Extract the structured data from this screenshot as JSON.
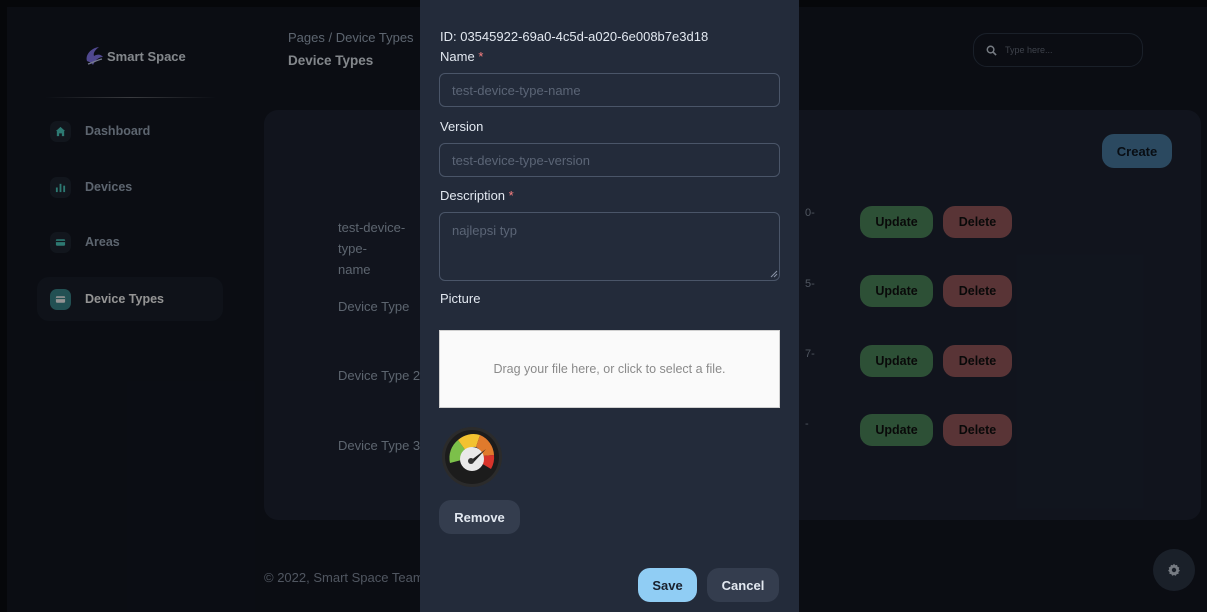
{
  "sidebar": {
    "logo_text": "Smart Space",
    "items": [
      {
        "label": "Dashboard",
        "icon": "home-icon"
      },
      {
        "label": "Devices",
        "icon": "bar-chart-icon"
      },
      {
        "label": "Areas",
        "icon": "credit-card-icon"
      },
      {
        "label": "Device Types",
        "icon": "credit-card-icon",
        "active": true
      }
    ]
  },
  "header": {
    "breadcrumb_root": "Pages",
    "breadcrumb_sep": "/",
    "breadcrumb_current": "Device Types",
    "title": "Device Types",
    "search_placeholder": "Type here..."
  },
  "main": {
    "create_label": "Create",
    "rows": [
      {
        "name": "test-device-type-\nname",
        "id_fragment": "0-",
        "update_label": "Update",
        "delete_label": "Delete"
      },
      {
        "name": "Device Type",
        "id_fragment": "5-",
        "update_label": "Update",
        "delete_label": "Delete"
      },
      {
        "name": "Device Type 2",
        "id_fragment": "7-",
        "update_label": "Update",
        "delete_label": "Delete"
      },
      {
        "name": "Device Type 3",
        "id_fragment": "-",
        "update_label": "Update",
        "delete_label": "Delete"
      }
    ]
  },
  "footer": {
    "text": "© 2022, Smart Space Team"
  },
  "modal": {
    "id_text": "ID: 03545922-69a0-4c5d-a020-6e008b7e3d18",
    "name_label": "Name",
    "name_placeholder": "test-device-type-name",
    "version_label": "Version",
    "version_placeholder": "test-device-type-version",
    "description_label": "Description",
    "description_placeholder": "najlepsi typ",
    "required_mark": "*",
    "picture_label": "Picture",
    "dropzone_text": "Drag your file here, or click to select a file.",
    "remove_label": "Remove",
    "save_label": "Save",
    "cancel_label": "Cancel"
  },
  "colors": {
    "accent": "#90cdf4",
    "update": "#4f8a5e",
    "delete": "#9a5b5d",
    "create": "#4a7fa6"
  }
}
